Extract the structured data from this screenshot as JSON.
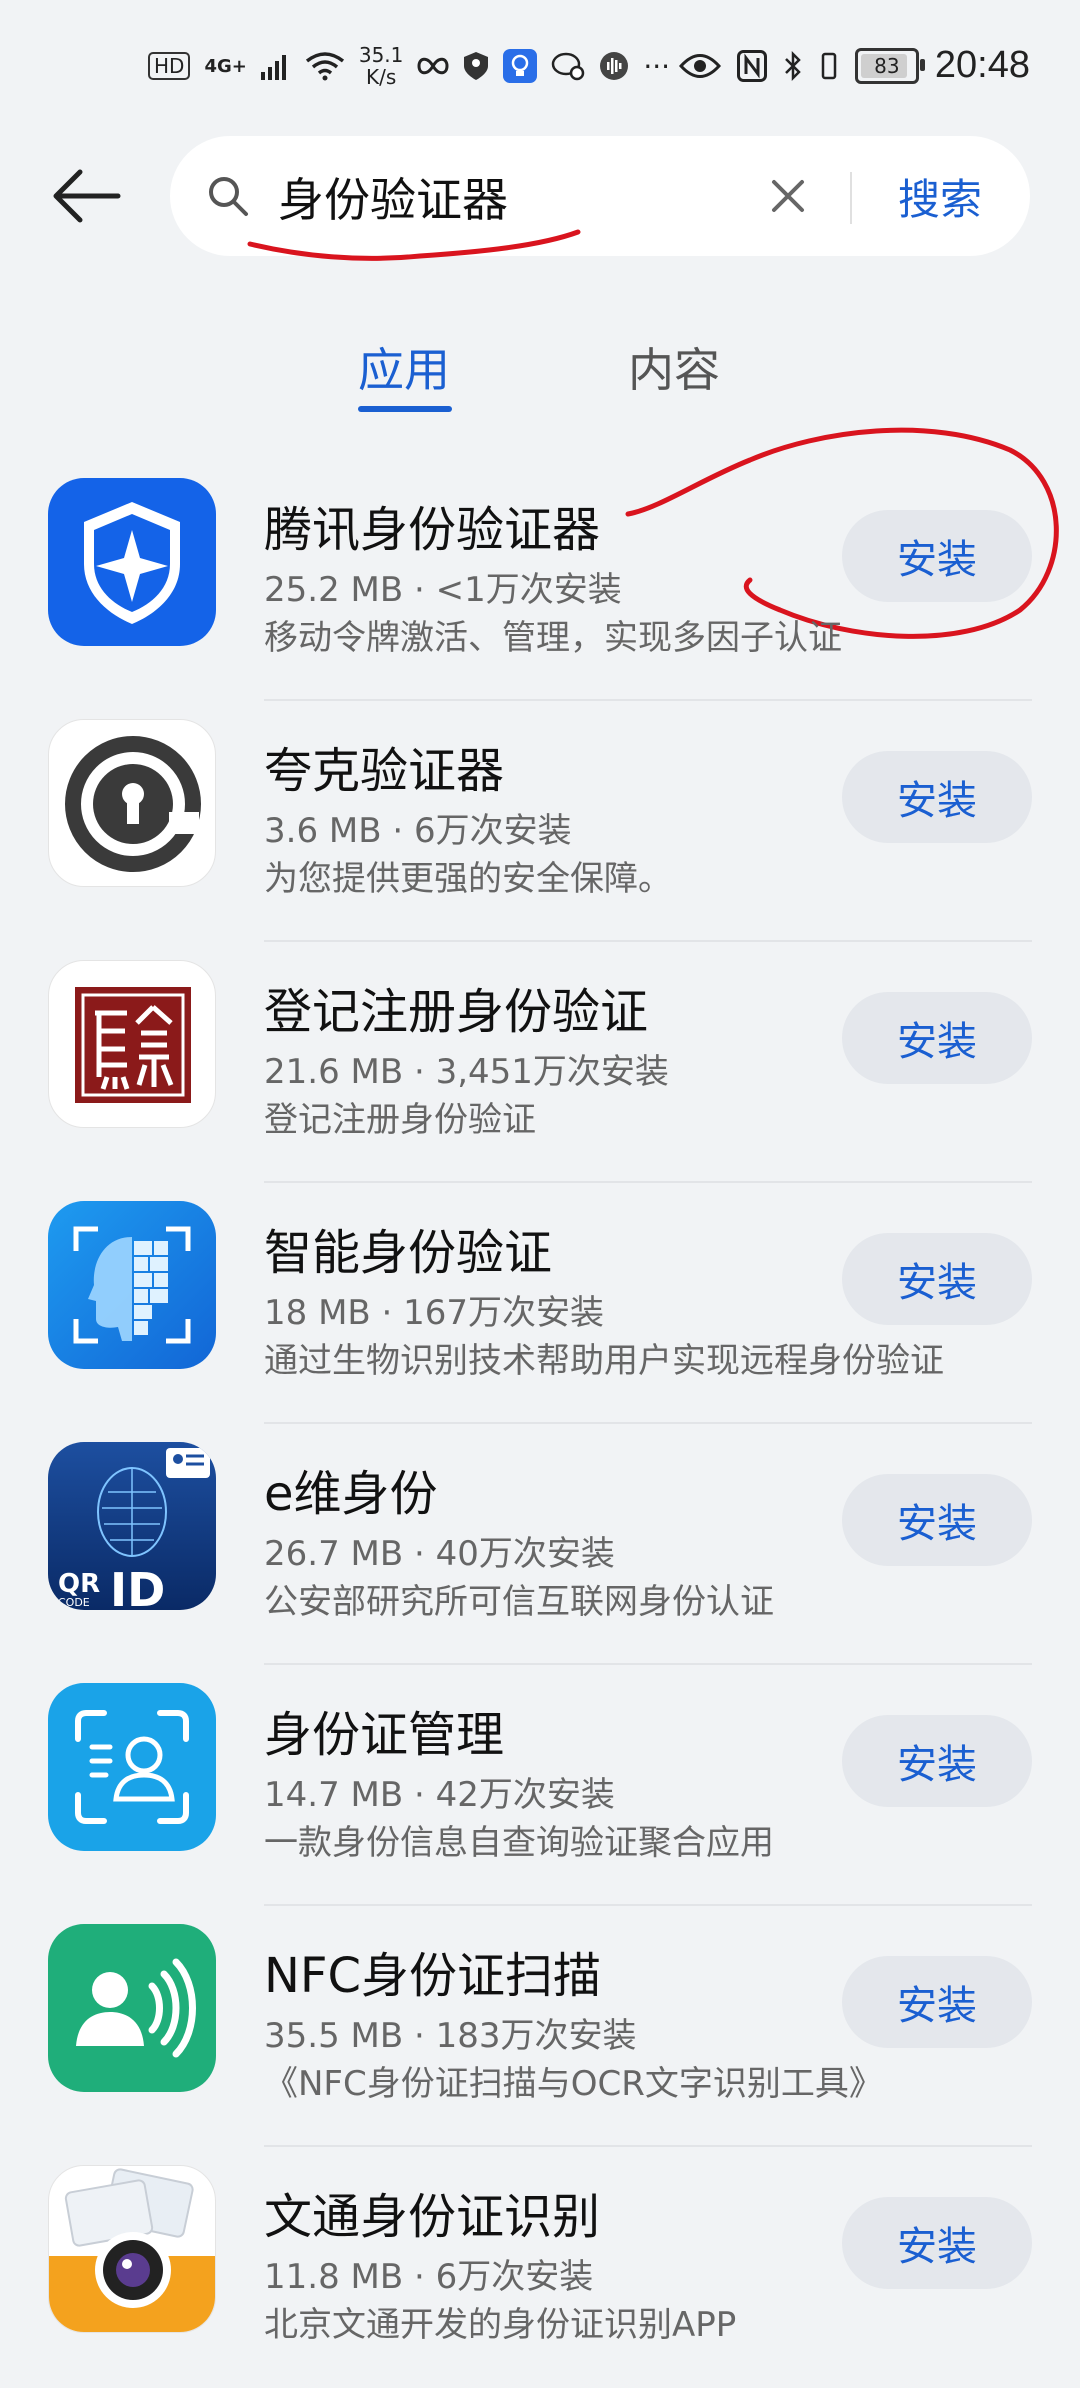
{
  "status": {
    "hd": "HD",
    "net": "4G+",
    "speed_value": "35.1",
    "speed_unit": "K/s",
    "battery": "83",
    "time": "20:48"
  },
  "search": {
    "query": "身份验证器",
    "button_label": "搜索"
  },
  "tabs": [
    {
      "label": "应用",
      "active": true
    },
    {
      "label": "内容",
      "active": false
    }
  ],
  "install_label": "安装",
  "apps": [
    {
      "name": "腾讯身份验证器",
      "meta": "25.2 MB · <1万次安装",
      "desc": "移动令牌激活、管理，实现多因子认证",
      "icon": "tencent-shield-icon"
    },
    {
      "name": "夸克验证器",
      "meta": "3.6 MB · 6万次安装",
      "desc": "为您提供更强的安全保障。",
      "icon": "keyhole-lock-icon"
    },
    {
      "name": "登记注册身份验证",
      "meta": "21.6 MB · 3,451万次安装",
      "desc": "登记注册身份验证",
      "icon": "red-seal-icon"
    },
    {
      "name": "智能身份验证",
      "meta": "18 MB · 167万次安装",
      "desc": "通过生物识别技术帮助用户实现远程身份验证",
      "icon": "face-scan-icon"
    },
    {
      "name": "e维身份",
      "meta": "26.7 MB · 40万次安装",
      "desc": "公安部研究所可信互联网身份认证",
      "icon": "qr-code-id-icon"
    },
    {
      "name": "身份证管理",
      "meta": "14.7 MB · 42万次安装",
      "desc": "一款身份信息自查询验证聚合应用",
      "icon": "id-scan-frame-icon"
    },
    {
      "name": "NFC身份证扫描",
      "meta": "35.5 MB · 183万次安装",
      "desc": "《NFC身份证扫描与OCR文字识别工具》",
      "icon": "nfc-person-icon"
    },
    {
      "name": "文通身份证识别",
      "meta": "11.8 MB · 6万次安装",
      "desc": "北京文通开发的身份证识别APP",
      "icon": "camera-id-card-icon"
    }
  ],
  "colors": {
    "accent": "#1a5fd1",
    "background": "#f1f3f5",
    "annotation": "#d9141e"
  }
}
